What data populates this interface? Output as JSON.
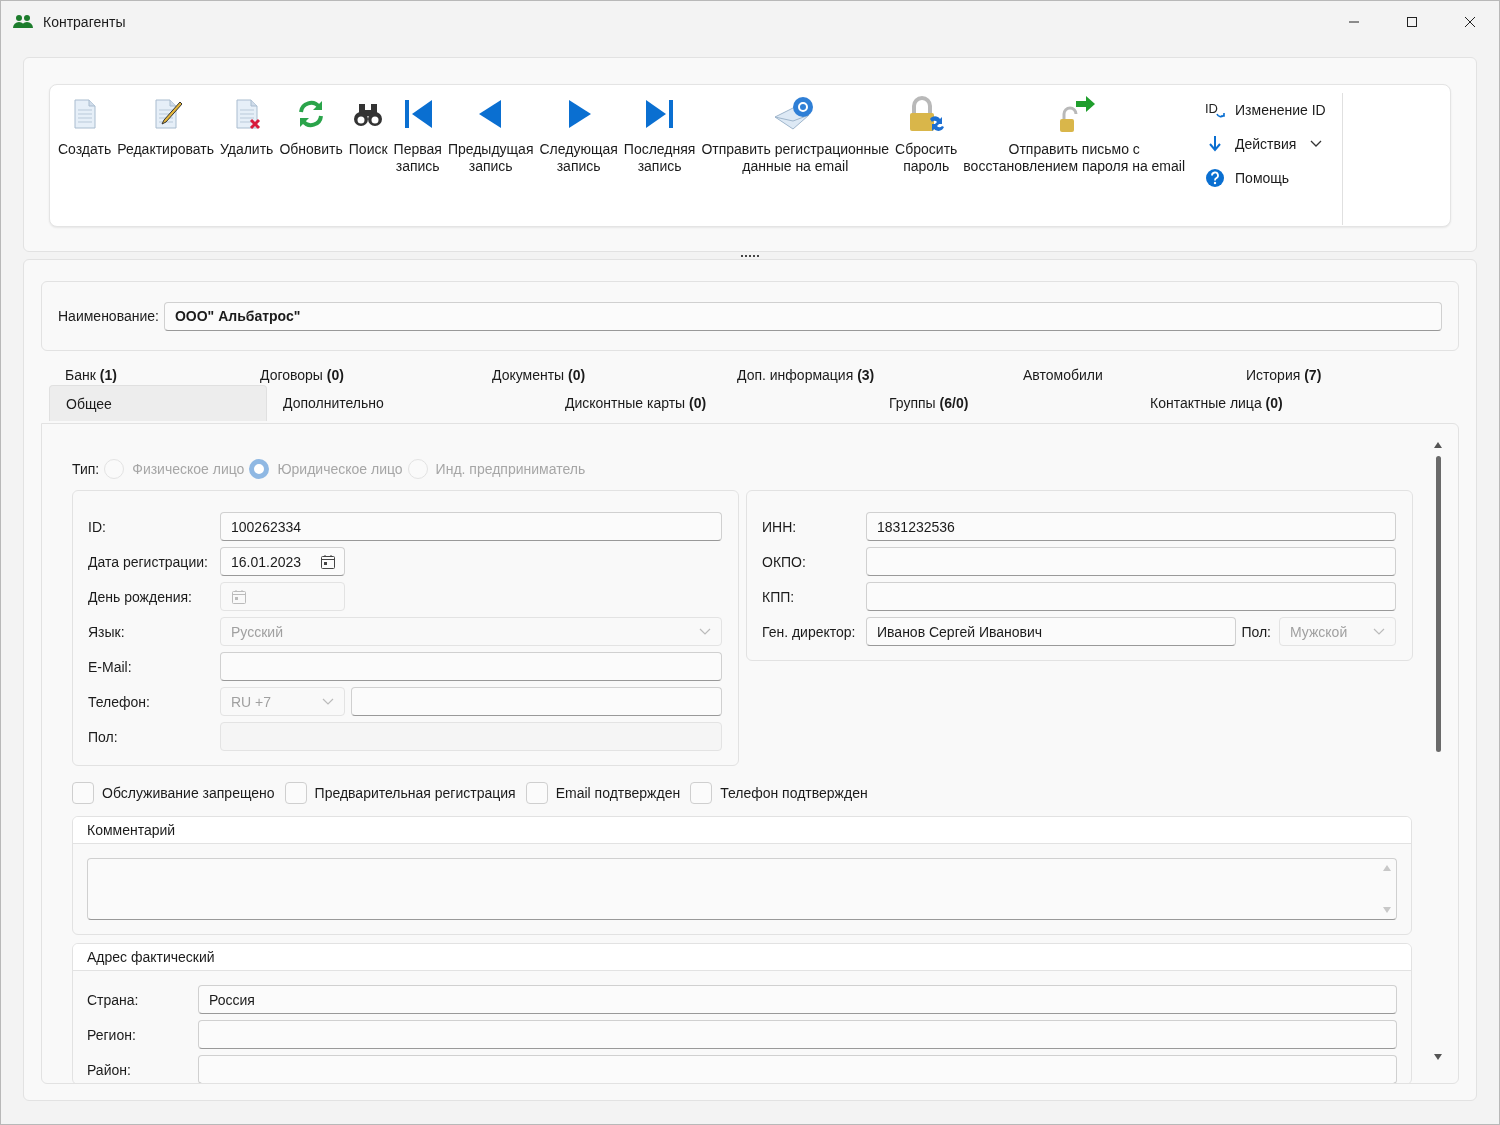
{
  "window": {
    "title": "Контрагенты"
  },
  "toolbar": {
    "buttons": [
      {
        "kind": "create",
        "label": "Создать"
      },
      {
        "kind": "edit",
        "label": "Редактировать"
      },
      {
        "kind": "delete",
        "label": "Удалить"
      },
      {
        "kind": "refresh",
        "label": "Обновить"
      },
      {
        "kind": "search",
        "label": "Поиск"
      },
      {
        "kind": "first",
        "label": "Первая\nзапись"
      },
      {
        "kind": "prev",
        "label": "Предыдущая\nзапись"
      },
      {
        "kind": "next",
        "label": "Следующая\nзапись"
      },
      {
        "kind": "last",
        "label": "Последняя\nзапись"
      },
      {
        "kind": "send_email",
        "label": "Отправить регистрационные\nданные на email"
      },
      {
        "kind": "reset_password",
        "label": "Сбросить\nпароль"
      },
      {
        "kind": "send_recovery",
        "label": "Отправить письмо с\nвосстановлением пароля на email"
      }
    ],
    "side_items": [
      {
        "kind": "change_id",
        "icon_text": "ID",
        "label": "Изменение ID"
      },
      {
        "kind": "actions",
        "label": "Действия"
      },
      {
        "kind": "help",
        "label": "Помощь"
      }
    ]
  },
  "name_field": {
    "label": "Наименование:",
    "value": "ООО\" Альбатрос\""
  },
  "tab_rows": [
    {
      "tabs": [
        {
          "label": "Банк **(1)**",
          "selected": false
        },
        {
          "label": "Договоры **(0)**",
          "selected": false
        },
        {
          "label": "Документы  **(0)**",
          "selected": false
        },
        {
          "label": "Доп. информация **(3)**",
          "selected": false
        },
        {
          "label": "Автомобили",
          "selected": false
        },
        {
          "label": "История **(7)**",
          "selected": false
        }
      ]
    },
    {
      "tabs": [
        {
          "label": "Общее",
          "selected": true
        },
        {
          "label": "Дополнительно",
          "selected": false
        },
        {
          "label": "Дисконтные карты **(0)**",
          "selected": false
        },
        {
          "label": "Группы **(6/0)**",
          "selected": false
        },
        {
          "label": "Контактные лица **(0)**",
          "selected": false
        }
      ]
    }
  ],
  "type_choice": {
    "label": "Тип:",
    "disabled": true,
    "options": [
      {
        "label": "Физическое лицо",
        "selected": false
      },
      {
        "label": "Юридическое лицо",
        "selected": true
      },
      {
        "label": "Инд. предприниматель",
        "selected": false
      }
    ]
  },
  "left_fields": [
    {
      "kind": "text",
      "label": "ID:",
      "value": "100262334",
      "disabled": false
    },
    {
      "kind": "date",
      "label": "Дата регистрации:",
      "value": "16.01.2023",
      "disabled": false
    },
    {
      "kind": "date",
      "label": "День рождения:",
      "disabled": true
    },
    {
      "kind": "select",
      "label": "Язык:",
      "value": "Русский",
      "disabled": true
    },
    {
      "kind": "text",
      "label": "E-Mail:",
      "disabled": false
    },
    {
      "kind": "phone",
      "label": "Телефон:",
      "code": "RU +7",
      "disabled": false
    },
    {
      "kind": "text",
      "label": "Пол:",
      "disabled": true
    }
  ],
  "right_fields": [
    {
      "kind": "text",
      "label": "ИНН:",
      "value": "1831232536",
      "disabled": false
    },
    {
      "kind": "text",
      "label": "ОКПО:",
      "disabled": false
    },
    {
      "kind": "text",
      "label": "КПП:",
      "disabled": false
    },
    {
      "kind": "text",
      "label": "Ген. директор:",
      "value": "Иванов Сергей Иванович",
      "disabled": false,
      "extra_label": "Пол:",
      "extra_value": "Мужской"
    }
  ],
  "checkboxes": [
    {
      "label": "Обслуживание запрещено",
      "checked": false
    },
    {
      "label": "Предварительная регистрация",
      "checked": false
    },
    {
      "label": "Email подтвержден",
      "checked": false
    },
    {
      "label": "Телефон подтвержден",
      "checked": false
    }
  ],
  "comment": {
    "title": "Комментарий"
  },
  "address": {
    "title": "Адрес фактический",
    "fields": [
      {
        "label": "Страна:",
        "value": "Россия"
      },
      {
        "label": "Регион:"
      },
      {
        "label": "Район:"
      }
    ]
  }
}
